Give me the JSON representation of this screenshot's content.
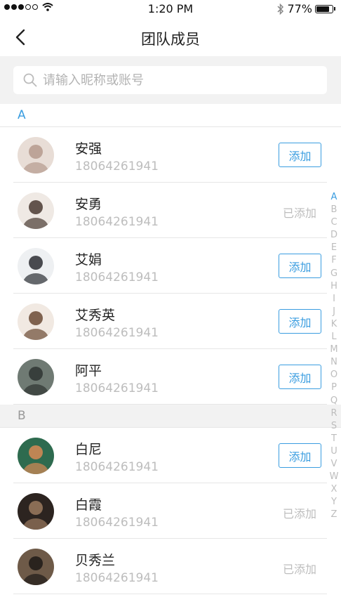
{
  "status_bar": {
    "time": "1:20 PM",
    "battery": "77%",
    "battery_level": 0.77
  },
  "nav": {
    "title": "团队成员"
  },
  "search": {
    "placeholder": "请输入昵称或账号"
  },
  "colors": {
    "accent": "#3a9de0",
    "muted": "#bdbdbd",
    "section_bg_a": "#ffffff",
    "section_bg_b": "#f2f2f2"
  },
  "sections": [
    {
      "letter": "A",
      "items": [
        {
          "name": "安强",
          "phone": "18064261941",
          "action": "添加",
          "added": false
        },
        {
          "name": "安勇",
          "phone": "18064261941",
          "action": "已添加",
          "added": true
        },
        {
          "name": "艾娟",
          "phone": "18064261941",
          "action": "添加",
          "added": false
        },
        {
          "name": "艾秀英",
          "phone": "18064261941",
          "action": "添加",
          "added": false
        },
        {
          "name": "阿平",
          "phone": "18064261941",
          "action": "添加",
          "added": false
        }
      ]
    },
    {
      "letter": "B",
      "items": [
        {
          "name": "白尼",
          "phone": "18064261941",
          "action": "添加",
          "added": false
        },
        {
          "name": "白霞",
          "phone": "18064261941",
          "action": "已添加",
          "added": true
        },
        {
          "name": "贝秀兰",
          "phone": "18064261941",
          "action": "已添加",
          "added": true
        }
      ]
    }
  ],
  "index_letters": [
    "A",
    "B",
    "C",
    "D",
    "E",
    "F",
    "G",
    "H",
    "I",
    "J",
    "K",
    "L",
    "M",
    "N",
    "O",
    "P",
    "Q",
    "R",
    "S",
    "T",
    "U",
    "V",
    "W",
    "X",
    "Y",
    "Z"
  ],
  "index_active": "A"
}
